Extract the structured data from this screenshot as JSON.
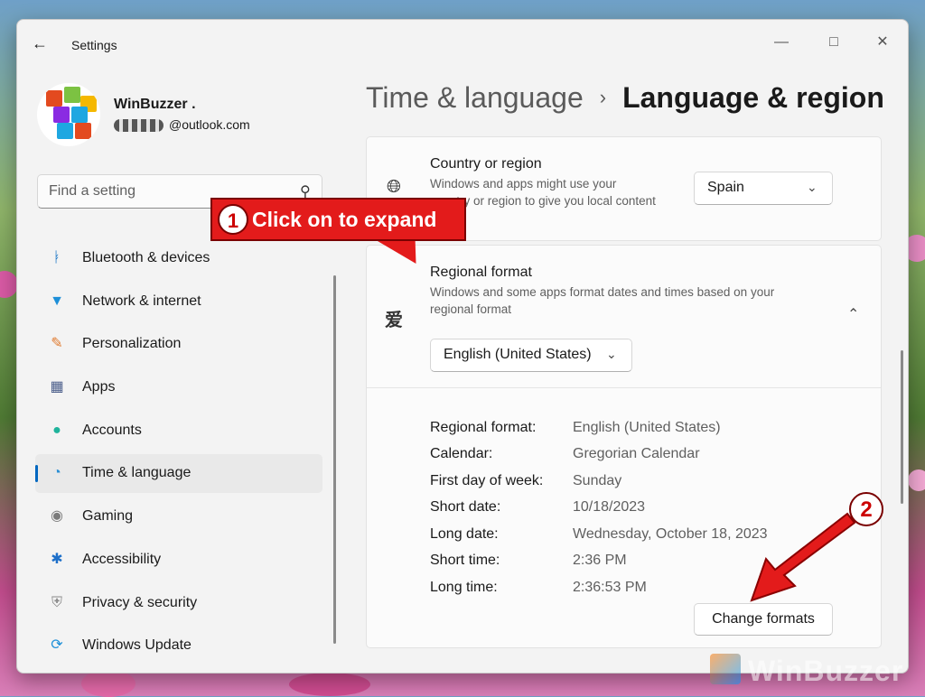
{
  "app": {
    "title": "Settings"
  },
  "user": {
    "name": "WinBuzzer .",
    "email": "@outlook.com"
  },
  "search": {
    "placeholder": "Find a setting"
  },
  "sidebar": {
    "items": [
      {
        "label": "Bluetooth & devices",
        "icon": "bluetooth-icon",
        "active": false
      },
      {
        "label": "Network & internet",
        "icon": "wifi-icon",
        "active": false
      },
      {
        "label": "Personalization",
        "icon": "brush-icon",
        "active": false
      },
      {
        "label": "Apps",
        "icon": "apps-icon",
        "active": false
      },
      {
        "label": "Accounts",
        "icon": "person-icon",
        "active": false
      },
      {
        "label": "Time & language",
        "icon": "globe-clock-icon",
        "active": true
      },
      {
        "label": "Gaming",
        "icon": "gamepad-icon",
        "active": false
      },
      {
        "label": "Accessibility",
        "icon": "accessibility-icon",
        "active": false
      },
      {
        "label": "Privacy & security",
        "icon": "shield-icon",
        "active": false
      },
      {
        "label": "Windows Update",
        "icon": "refresh-icon",
        "active": false
      }
    ]
  },
  "header": {
    "parent": "Time & language",
    "separator": "›",
    "current": "Language & region"
  },
  "country": {
    "title": "Country or region",
    "description": "Windows and apps might use your country or region to give you local content",
    "value": "Spain"
  },
  "regional": {
    "title": "Regional format",
    "description": "Windows and some apps format dates and times based on your regional format",
    "value": "English (United States)",
    "details": [
      {
        "label": "Regional format:",
        "value": "English (United States)"
      },
      {
        "label": "Calendar:",
        "value": "Gregorian Calendar"
      },
      {
        "label": "First day of week:",
        "value": "Sunday"
      },
      {
        "label": "Short date:",
        "value": "10/18/2023"
      },
      {
        "label": "Long date:",
        "value": "Wednesday, October 18, 2023"
      },
      {
        "label": "Short time:",
        "value": "2:36 PM"
      },
      {
        "label": "Long time:",
        "value": "2:36:53 PM"
      }
    ],
    "change_button": "Change formats"
  },
  "annotations": {
    "step1_number": "1",
    "step1_text": "Click on to expand",
    "step2_number": "2"
  },
  "watermark": "WinBuzzer",
  "colors": {
    "accent": "#0067c0",
    "callout": "#e31b1b"
  }
}
